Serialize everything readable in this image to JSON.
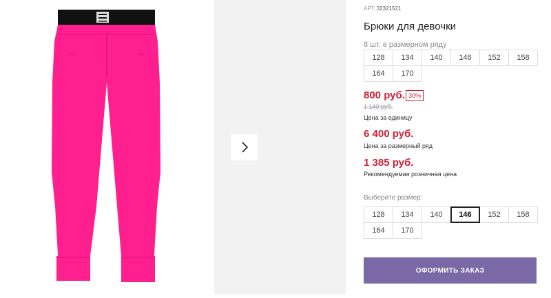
{
  "product": {
    "article_label": "АРТ.",
    "article_number": "32321521",
    "title": "Брюки для девочки",
    "pack_note": "8 шт. в размерном ряду",
    "pack_sizes": [
      "128",
      "134",
      "140",
      "146",
      "152",
      "158",
      "164",
      "170"
    ]
  },
  "prices": {
    "unit_price": "800 руб.",
    "discount": "30%",
    "old_price": "1 140 руб.",
    "unit_label": "Цена за единицу",
    "set_price": "6 400 руб.",
    "set_label": "Цена за размерный ряд",
    "retail_price": "1 385 руб.",
    "retail_label": "Рекомендуемая розничная цена"
  },
  "size_select": {
    "label": "Выберите размер:",
    "sizes": [
      "128",
      "134",
      "140",
      "146",
      "152",
      "158",
      "164",
      "170"
    ],
    "selected": "146"
  },
  "order_button": "ОФОРМИТЬ ЗАКАЗ",
  "colors": {
    "accent_purple": "#7b68a6",
    "price_red": "#d0213a",
    "pants_pink": "#ff1f8e"
  },
  "icons": {
    "next": "chevron-right-icon"
  }
}
